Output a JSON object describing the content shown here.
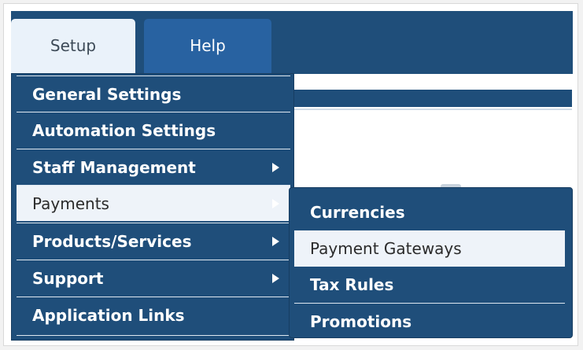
{
  "tabs": [
    {
      "label": "Setup"
    },
    {
      "label": "Help"
    }
  ],
  "setup_menu": {
    "items": [
      {
        "label": "General Settings",
        "has_submenu": false
      },
      {
        "label": "Automation Settings",
        "has_submenu": false
      },
      {
        "label": "Staff Management",
        "has_submenu": true
      },
      {
        "label": "Payments",
        "has_submenu": true,
        "active": true
      },
      {
        "label": "Products/Services",
        "has_submenu": true
      },
      {
        "label": "Support",
        "has_submenu": true
      },
      {
        "label": "Application Links",
        "has_submenu": false
      }
    ]
  },
  "payments_submenu": {
    "items": [
      {
        "label": "Currencies"
      },
      {
        "label": "Payment Gateways",
        "active": true
      },
      {
        "label": "Tax Rules"
      },
      {
        "label": "Promotions"
      }
    ]
  },
  "colors": {
    "navy": "#1f4e7a",
    "tab_active_bg": "#eaf2fa",
    "tab_help_bg": "#2862a1",
    "highlight_bg": "#eef3f9"
  }
}
